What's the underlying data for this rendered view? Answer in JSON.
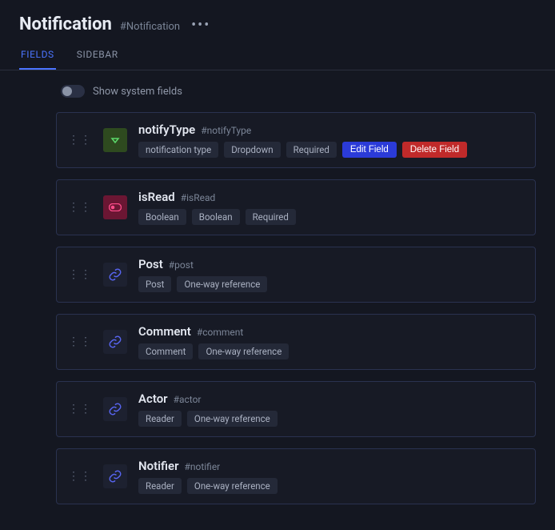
{
  "header": {
    "title": "Notification",
    "slug": "#Notification"
  },
  "tabs": {
    "fields": "FIELDS",
    "sidebar": "SIDEBAR"
  },
  "toggle": {
    "label": "Show system fields"
  },
  "buttons": {
    "edit": "Edit Field",
    "delete": "Delete Field"
  },
  "fields": [
    {
      "name": "notifyType",
      "slug": "#notifyType",
      "icon": "dropdown",
      "badges": [
        "notification type",
        "Dropdown",
        "Required"
      ],
      "showActions": true
    },
    {
      "name": "isRead",
      "slug": "#isRead",
      "icon": "boolean",
      "badges": [
        "Boolean",
        "Boolean",
        "Required"
      ],
      "showActions": false
    },
    {
      "name": "Post",
      "slug": "#post",
      "icon": "link",
      "badges": [
        "Post",
        "One-way reference"
      ],
      "showActions": false
    },
    {
      "name": "Comment",
      "slug": "#comment",
      "icon": "link",
      "badges": [
        "Comment",
        "One-way reference"
      ],
      "showActions": false
    },
    {
      "name": "Actor",
      "slug": "#actor",
      "icon": "link",
      "badges": [
        "Reader",
        "One-way reference"
      ],
      "showActions": false
    },
    {
      "name": "Notifier",
      "slug": "#notifier",
      "icon": "link",
      "badges": [
        "Reader",
        "One-way reference"
      ],
      "showActions": false
    }
  ]
}
